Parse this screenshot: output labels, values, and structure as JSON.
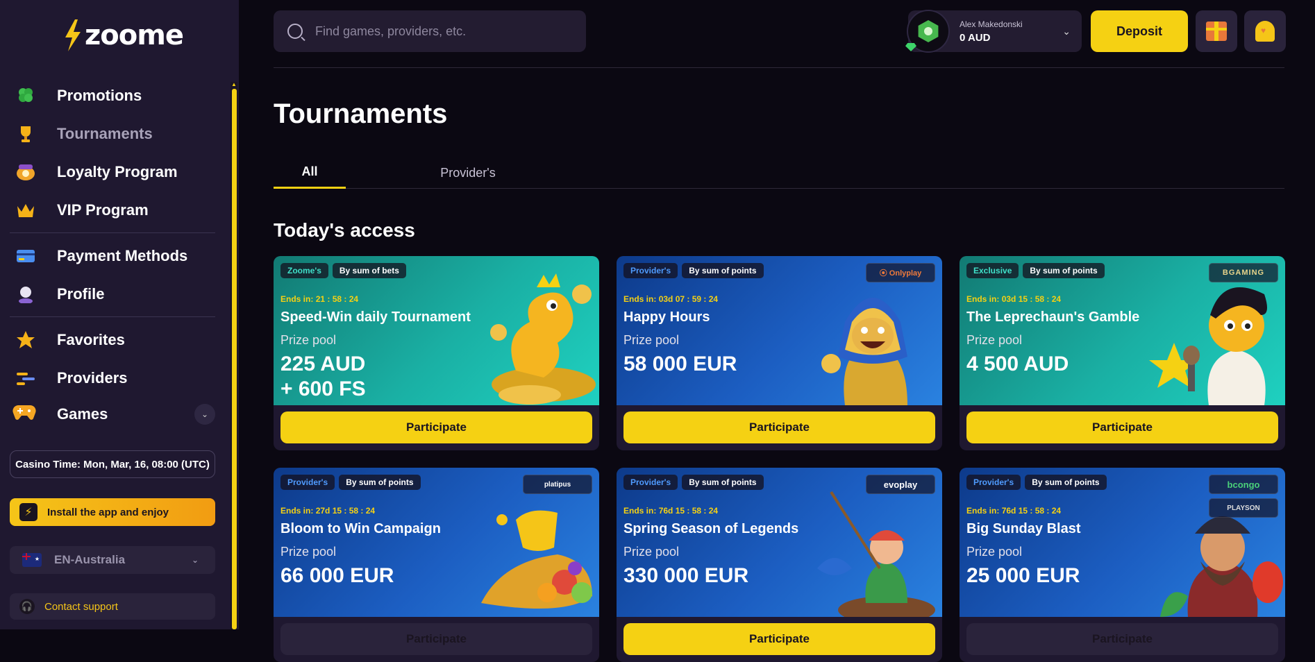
{
  "brand": {
    "logo_text": "zoome",
    "accent": "#f5d113"
  },
  "sidebar": {
    "items": [
      {
        "label": "Promotions",
        "icon": "clover-icon"
      },
      {
        "label": "Tournaments",
        "icon": "trophy-icon"
      },
      {
        "label": "Loyalty Program",
        "icon": "loyalty-chest-icon"
      },
      {
        "label": "VIP Program",
        "icon": "crown-icon"
      },
      {
        "label": "Payment Methods",
        "icon": "card-icon"
      },
      {
        "label": "Profile",
        "icon": "profile-icon"
      },
      {
        "label": "Favorites",
        "icon": "star-icon"
      },
      {
        "label": "Providers",
        "icon": "providers-icon"
      },
      {
        "label": "Games",
        "icon": "gamepad-icon"
      }
    ],
    "casino_time": "Casino Time: Mon, Mar, 16, 08:00 (UTC)",
    "install_label": "Install the app and enjoy",
    "language": "EN-Australia",
    "support_label": "Contact support"
  },
  "header": {
    "search_placeholder": "Find games, providers, etc.",
    "user_name": "Alex Makedonski",
    "balance": "0 AUD",
    "deposit_label": "Deposit"
  },
  "main": {
    "title": "Tournaments",
    "tabs": [
      {
        "label": "All",
        "active": true
      },
      {
        "label": "Provider's",
        "active": false
      }
    ],
    "section_title": "Today's access",
    "cards": [
      {
        "type_badge": "Zoome's",
        "mode_badge": "By sum of bets",
        "provider_logo": "",
        "ends_label": "Ends in:",
        "ends_value": "21 : 58 : 24",
        "name": "Speed-Win daily Tournament",
        "prize_label": "Prize pool",
        "prize_line1": "225 AUD",
        "prize_line2": "+ 600 FS",
        "button": "Participate",
        "theme": "teal"
      },
      {
        "type_badge": "Provider's",
        "mode_badge": "By sum of points",
        "provider_logo": "⦿ Onlyplay",
        "ends_label": "Ends in:",
        "ends_value": "03d 07 : 59 : 24",
        "name": "Happy Hours",
        "prize_label": "Prize pool",
        "prize_line1": "58 000 EUR",
        "prize_line2": "",
        "button": "Participate",
        "theme": "blue"
      },
      {
        "type_badge": "Exclusive",
        "mode_badge": "By sum of points",
        "provider_logo": "BGAMING",
        "ends_label": "Ends in:",
        "ends_value": "03d 15 : 58 : 24",
        "name": "The Leprechaun's Gamble",
        "prize_label": "Prize pool",
        "prize_line1": "4 500 AUD",
        "prize_line2": "",
        "button": "Participate",
        "theme": "teal"
      },
      {
        "type_badge": "Provider's",
        "mode_badge": "By sum of points",
        "provider_logo": "platipus",
        "ends_label": "Ends in:",
        "ends_value": "27d 15 : 58 : 24",
        "name": "Bloom to Win Campaign",
        "prize_label": "Prize pool",
        "prize_line1": "66 000 EUR",
        "prize_line2": "",
        "button": "Participate",
        "theme": "blue"
      },
      {
        "type_badge": "Provider's",
        "mode_badge": "By sum of points",
        "provider_logo": "evoplay",
        "ends_label": "Ends in:",
        "ends_value": "76d 15 : 58 : 24",
        "name": "Spring Season of Legends",
        "prize_label": "Prize pool",
        "prize_line1": "330 000 EUR",
        "prize_line2": "",
        "button": "Participate",
        "theme": "blue"
      },
      {
        "type_badge": "Provider's",
        "mode_badge": "By sum of points",
        "provider_logo": "bcongo",
        "provider_logo2": "PLAYSON",
        "ends_label": "Ends in:",
        "ends_value": "76d 15 : 58 : 24",
        "name": "Big Sunday Blast",
        "prize_label": "Prize pool",
        "prize_line1": "25 000 EUR",
        "prize_line2": "",
        "button": "Participate",
        "theme": "blue"
      }
    ]
  }
}
